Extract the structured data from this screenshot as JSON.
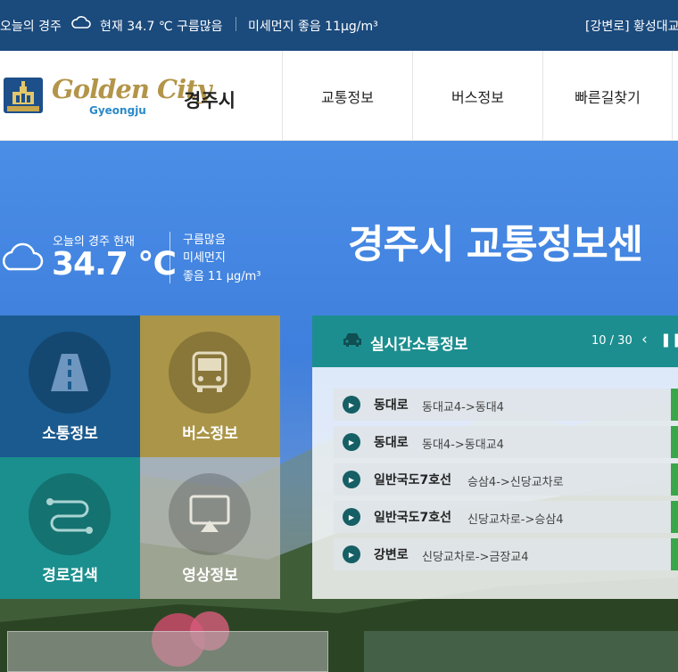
{
  "topbar": {
    "today_label": "오늘의 경주",
    "weather_current": "현재 34.7 ℃ 구름많음",
    "dust": "미세먼지 좋음 11μg/m³",
    "road_notice": "[강변로] 황성대교"
  },
  "header": {
    "logo_brand": "Golden City",
    "logo_sub": "Gyeongju",
    "logo_city": "경주시",
    "menu": [
      "교통정보",
      "버스정보",
      "빠른길찾기"
    ]
  },
  "weather": {
    "label": "오늘의 경주 현재",
    "temp": "34.7 ℃",
    "condition": "구름많음",
    "dust_label": "미세먼지",
    "dust_value": "좋음 11 μg/m³"
  },
  "hero": {
    "title": "경주시 교통정보센"
  },
  "tiles": [
    {
      "label": "소통정보",
      "color": "#1a5a8e",
      "icon": "road-icon"
    },
    {
      "label": "버스정보",
      "color": "#ab9548",
      "icon": "bus-icon"
    },
    {
      "label": "경로검색",
      "color": "#1a8f8e",
      "icon": "route-icon"
    },
    {
      "label": "영상정보",
      "color": "#9e9e92",
      "icon": "cctv-screen-icon"
    }
  ],
  "realtime": {
    "title": "실시간소통정보",
    "page": "10 / 30",
    "rows": [
      {
        "road": "동대로",
        "section": "동대교4->동대4"
      },
      {
        "road": "동대로",
        "section": "동대4->동대교4"
      },
      {
        "road": "일반국도7호선",
        "section": "승삼4->신당교차로"
      },
      {
        "road": "일반국도7호선",
        "section": "신당교차로->승삼4"
      },
      {
        "road": "강변로",
        "section": "신당교차로->금장교4"
      }
    ]
  },
  "colors": {
    "topbar": "#1b4a7c",
    "panel_head": "#1c8e8f",
    "status_green": "#3aa64a"
  }
}
